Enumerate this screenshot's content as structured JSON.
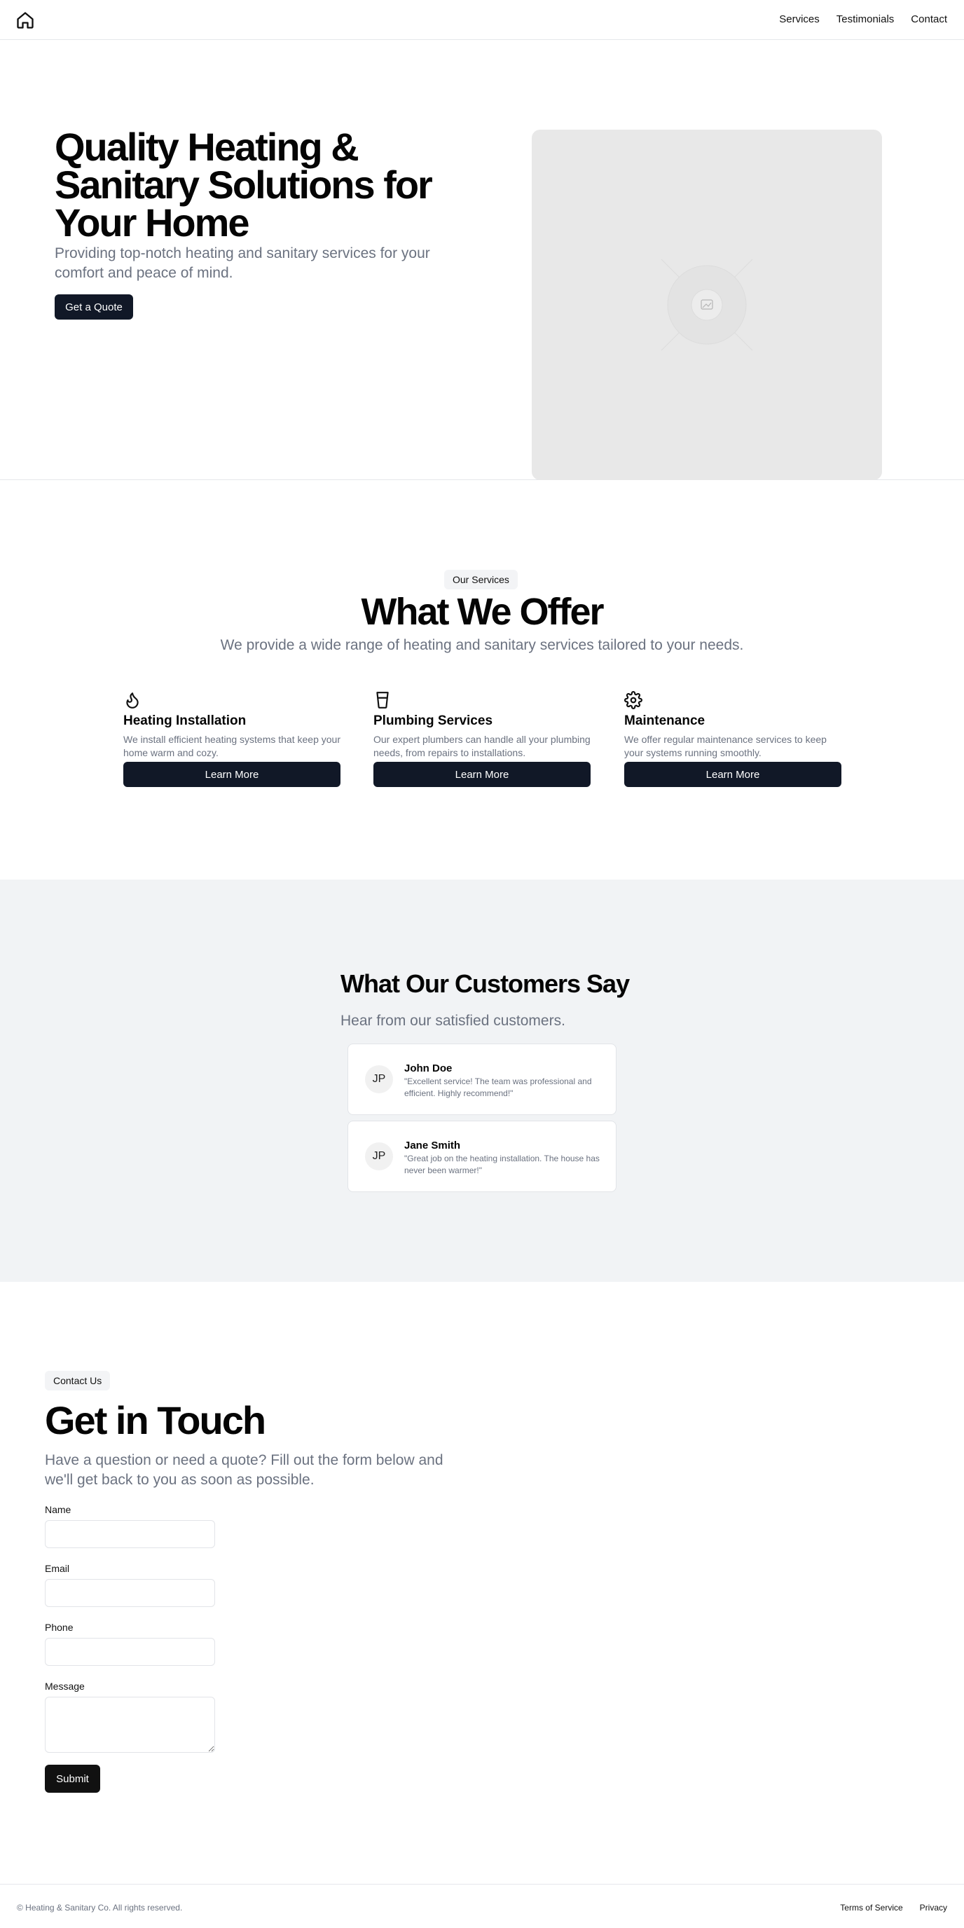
{
  "header": {
    "logo_icon": "home-icon",
    "nav": [
      "Services",
      "Testimonials",
      "Contact"
    ]
  },
  "hero": {
    "title": "Quality Heating & Sanitary Solutions for Your Home",
    "subtitle": "Providing top-notch heating and sanitary services for your comfort and peace of mind.",
    "cta": "Get a Quote",
    "image_icon": "image-placeholder-icon"
  },
  "services": {
    "badge": "Our Services",
    "title": "What We Offer",
    "subtitle": "We provide a wide range of heating and sanitary services tailored to your needs.",
    "items": [
      {
        "icon": "flame-icon",
        "title": "Heating Installation",
        "description": "We install efficient heating systems that keep your home warm and cozy.",
        "button": "Learn More"
      },
      {
        "icon": "glass-icon",
        "title": "Plumbing Services",
        "description": "Our expert plumbers can handle all your plumbing needs, from repairs to installations.",
        "button": "Learn More"
      },
      {
        "icon": "gear-icon",
        "title": "Maintenance",
        "description": "We offer regular maintenance services to keep your systems running smoothly.",
        "button": "Learn More"
      }
    ]
  },
  "testimonials": {
    "title": "What Our Customers Say",
    "subtitle": "Hear from our satisfied customers.",
    "items": [
      {
        "initials": "JP",
        "name": "John Doe",
        "quote": "\"Excellent service! The team was professional and efficient. Highly recommend!\""
      },
      {
        "initials": "JP",
        "name": "Jane Smith",
        "quote": "\"Great job on the heating installation. The house has never been warmer!\""
      }
    ]
  },
  "contact": {
    "badge": "Contact Us",
    "title": "Get in Touch",
    "subtitle": "Have a question or need a quote? Fill out the form below and we'll get back to you as soon as possible.",
    "fields": {
      "name": {
        "label": "Name",
        "value": ""
      },
      "email": {
        "label": "Email",
        "value": ""
      },
      "phone": {
        "label": "Phone",
        "value": ""
      },
      "message": {
        "label": "Message",
        "value": ""
      }
    },
    "submit": "Submit"
  },
  "footer": {
    "copyright": "© Heating & Sanitary Co. All rights reserved.",
    "links": [
      "Terms of Service",
      "Privacy"
    ]
  },
  "colors": {
    "primary_button": "#111827",
    "muted_text": "#6b7280",
    "section_bg": "#f1f3f5",
    "border": "#e5e7eb"
  }
}
